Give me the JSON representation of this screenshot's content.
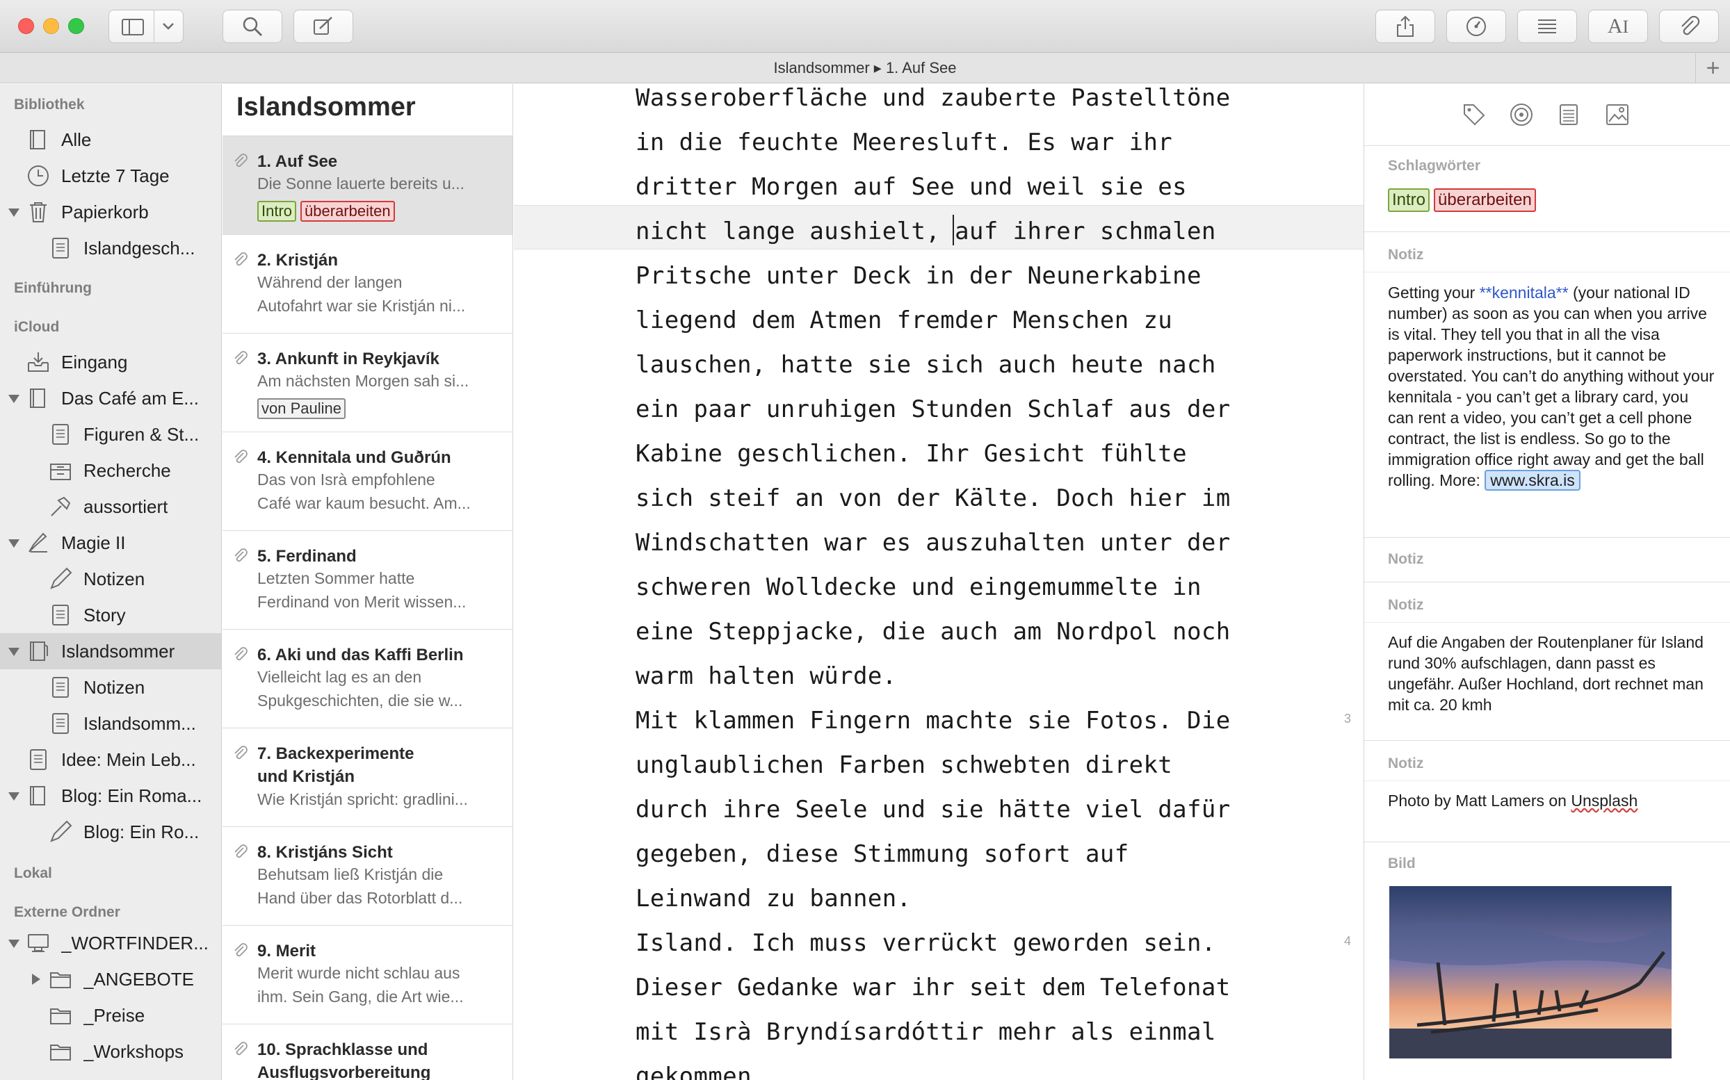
{
  "window": {
    "title": "Islandsommer ▸ 1. Auf See",
    "add_button": "+"
  },
  "toolbar": {
    "left_icons": [
      "sidebar-toggle-icon",
      "chevron-down-icon",
      "search-icon",
      "compose-icon"
    ],
    "right_icons": [
      "share-icon",
      "goals-gauge-icon",
      "outline-list-icon",
      "typewriter-font-icon",
      "attachment-clip-icon"
    ]
  },
  "sidebar": {
    "sections": {
      "bibliothek": "Bibliothek",
      "einfuehrung": "Einführung",
      "icloud": "iCloud",
      "lokal": "Lokal",
      "externe": "Externe Ordner"
    },
    "items": {
      "alle": "Alle",
      "letzte7": "Letzte 7 Tage",
      "papierkorb": "Papierkorb",
      "islandgesch": "Islandgesch...",
      "eingang": "Eingang",
      "cafe": "Das Café am E...",
      "figuren": "Figuren & St...",
      "recherche": "Recherche",
      "aussortiert": "aussortiert",
      "magie": "Magie II",
      "magie_notizen": "Notizen",
      "story": "Story",
      "islandsommer": "Islandsommer",
      "is_notizen": "Notizen",
      "islandsomm": "Islandsomm...",
      "idee": "Idee: Mein Leb...",
      "blog": "Blog: Ein Roma...",
      "blog_child": "Blog: Ein Ro...",
      "wortfinder": "_WORTFINDER...",
      "angebote": "_ANGEBOTE",
      "preise": "_Preise",
      "workshops": "_Workshops"
    }
  },
  "doclist": {
    "title": "Islandsommer",
    "docs": [
      {
        "title": "1. Auf See",
        "line1": "Die Sonne lauerte bereits u...",
        "line2": ""
      },
      {
        "title": "2. Kristján",
        "line1": "Während der langen",
        "line2": "Autofahrt war sie Kristján ni..."
      },
      {
        "title": "3. Ankunft in Reykjavík",
        "line1": "Am nächsten Morgen sah si...",
        "line2": ""
      },
      {
        "title": "4. Kennitala und Guðrún",
        "line1": "Das von Isrà empfohlene",
        "line2": "Café war kaum besucht. Am..."
      },
      {
        "title": "5. Ferdinand",
        "line1": "Letzten Sommer hatte",
        "line2": "Ferdinand von Merit wissen..."
      },
      {
        "title": "6. Aki und das Kaffi Berlin",
        "line1": "Vielleicht lag es an den",
        "line2": "Spukgeschichten, die sie w..."
      },
      {
        "title": "7. Backexperimente",
        "title2": "und Kristján",
        "line1": "Wie Kristján spricht: gradlini...",
        "line2": ""
      },
      {
        "title": "8. Kristjáns Sicht",
        "line1": "Behutsam ließ Kristján die",
        "line2": "Hand über das Rotorblatt d..."
      },
      {
        "title": "9. Merit",
        "line1": "Merit wurde nicht schlau aus",
        "line2": "ihm. Sein Gang, die Art wie..."
      },
      {
        "title": "10. Sprachklasse und",
        "title2": "Ausflugsvorbereitung",
        "line1": "",
        "line2": ""
      }
    ],
    "tags": {
      "intro": "Intro",
      "ueberarbeiten": "überarbeiten",
      "pauline": "von Pauline"
    }
  },
  "editor": {
    "lines": [
      "Wasseroberfläche und zauberte Pastelltöne",
      "in die feuchte Meeresluft. Es war ihr",
      "dritter Morgen auf See und weil sie es",
      "nicht lange aushielt, auf ihrer schmalen",
      "Pritsche unter Deck in der Neunerkabine",
      "liegend dem Atmen fremder Menschen zu",
      "lauschen, hatte sie sich auch heute nach",
      "ein paar unruhigen Stunden Schlaf aus der",
      "Kabine geschlichen. Ihr Gesicht fühlte",
      "sich steif an von der Kälte. Doch hier im",
      "Windschatten war es auszuhalten unter der",
      "schweren Wolldecke und eingemummelte in",
      "eine Steppjacke, die auch am Nordpol noch",
      "warm halten würde.",
      "Mit klammen Fingern machte sie Fotos. Die",
      "unglaublichen Farben schwebten direkt",
      "durch ihre Seele und sie hätte viel dafür",
      "gegeben, diese Stimmung sofort auf",
      "Leinwand zu bannen.",
      "Island. Ich muss verrückt geworden sein.",
      "Dieser Gedanke war ihr seit dem Telefonat",
      "mit Isrà Bryndísardóttir mehr als einmal",
      "gekommen."
    ],
    "paragraph_numbers": {
      "p3": "3",
      "p4": "4"
    }
  },
  "inspector": {
    "tab_icons": [
      "tag-icon",
      "target-icon",
      "notes-icon",
      "image-icon"
    ],
    "keywords_header": "Schlagwörter",
    "keywords": [
      "Intro",
      "überarbeiten"
    ],
    "note1_header": "Notiz",
    "note1": {
      "a": "Getting your ",
      "kw": "**kennitala**",
      "b": " (your national ID number) as soon as you can when you arrive is vital. They tell you that in all the visa paperwork instructions, but it cannot be overstated. You can’t do anything without your ",
      "kennitala": "kennitala",
      "c": " - you can’t get a library card, you can rent a video, you can’t get a cell phone contract, the list is endless. So go to the immigration office right away and get the ball rolling. More: ",
      "link": "www.skra.is"
    },
    "note2_header": "Notiz",
    "note3_header": "Notiz",
    "note3": "Auf die Angaben der Routenplaner für Island rund 30% aufschlagen, dann passt es ungefähr. Außer Hochland, dort rechnet man mit ca. 20 kmh",
    "note4_header": "Notiz",
    "note4": {
      "a": "Photo by Matt Lamers on ",
      "b": "Unsplash"
    },
    "image_header": "Bild"
  }
}
